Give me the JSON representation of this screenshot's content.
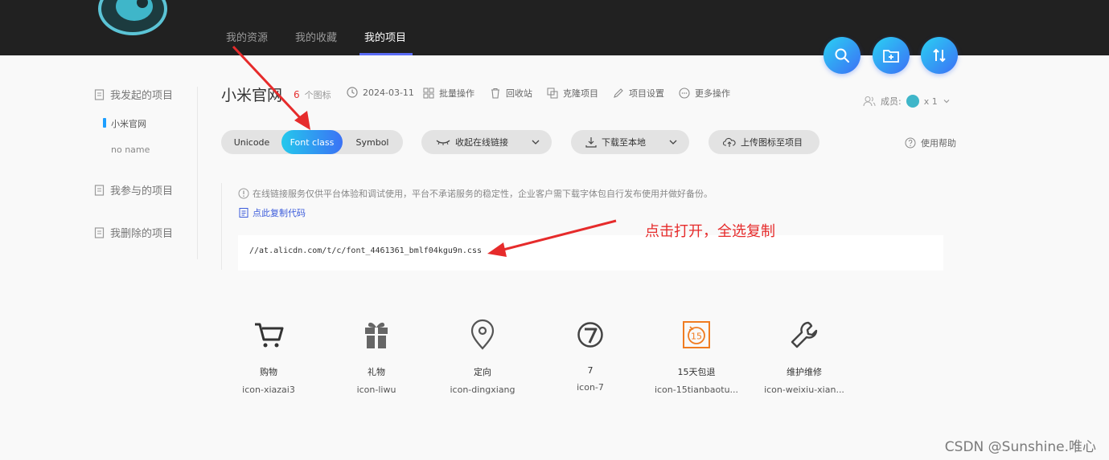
{
  "nav": {
    "tabs": [
      {
        "label": "我的资源"
      },
      {
        "label": "我的收藏"
      },
      {
        "label": "我的项目"
      }
    ]
  },
  "sidebar": {
    "initiated": "我发起的项目",
    "sub_active": "小米官网",
    "sub_other": "no name",
    "joined": "我参与的项目",
    "deleted": "我删除的项目"
  },
  "project": {
    "title": "小米官网",
    "icon_count": "6",
    "icon_count_label": "个图标",
    "date": "2024-03-11",
    "batch": "批量操作",
    "recycle": "回收站",
    "clone": "克隆项目",
    "settings": "项目设置",
    "more": "更多操作",
    "members_label": "成员:",
    "members_count": "x 1"
  },
  "tabs": {
    "unicode": "Unicode",
    "fontclass": "Font class",
    "symbol": "Symbol"
  },
  "actions": {
    "collapse_link": "收起在线链接",
    "download": "下载至本地",
    "upload": "上传图标至项目",
    "help": "使用帮助"
  },
  "notice": {
    "text": "在线链接服务仅供平台体验和调试使用，平台不承诺服务的稳定性，企业客户需下载字体包自行发布使用并做好备份。",
    "copy_link": "点此复制代码",
    "css_url": "//at.alicdn.com/t/c/font_4461361_bmlf04kgu9n.css"
  },
  "annotation": "点击打开，全选复制",
  "icons": [
    {
      "name": "购物",
      "code": "icon-xiazai3",
      "glyph": "cart-icon"
    },
    {
      "name": "礼物",
      "code": "icon-liwu",
      "glyph": "gift-icon"
    },
    {
      "name": "定向",
      "code": "icon-dingxiang",
      "glyph": "location-pin-icon"
    },
    {
      "name": "7",
      "code": "icon-7",
      "glyph": "seven-icon"
    },
    {
      "name": "15天包退",
      "code": "icon-15tianbaotu...",
      "glyph": "fifteen-day-return-icon"
    },
    {
      "name": "维护维修",
      "code": "icon-weixiu-xian...",
      "glyph": "wrench-icon"
    }
  ],
  "colors": {
    "accent": "#3b72f5",
    "accent_start": "#24c8ec",
    "annotation": "#e62b2b",
    "count": "#e63131",
    "orange_icon": "#f07c21"
  },
  "watermark": "CSDN @Sunshine.唯心"
}
